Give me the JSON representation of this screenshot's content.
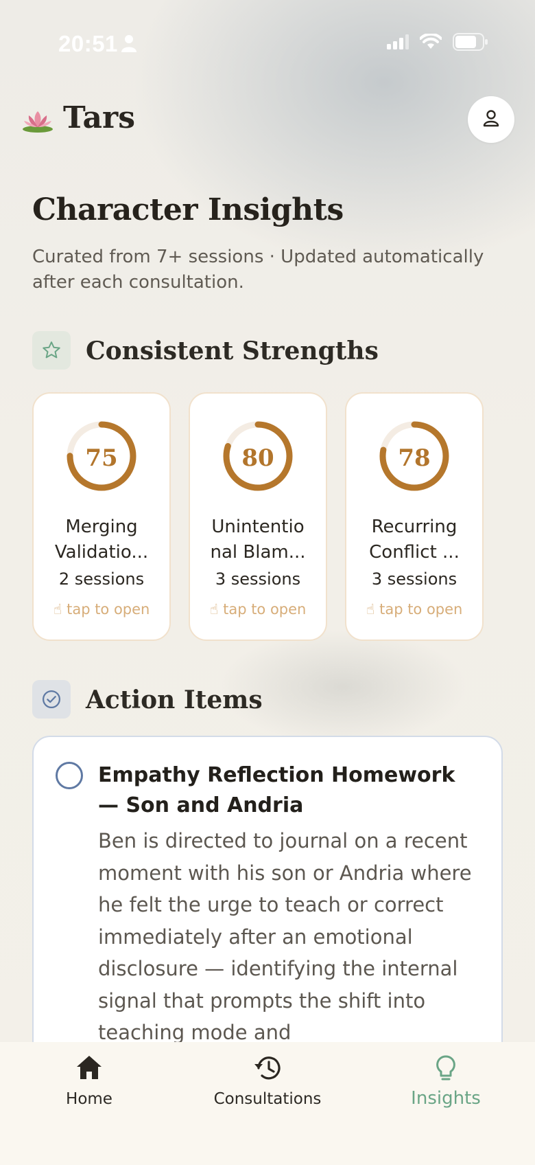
{
  "status_bar": {
    "time": "20:51"
  },
  "header": {
    "app_name": "Tars"
  },
  "page": {
    "title": "Character Insights",
    "subtitle": "Curated from 7+ sessions · Updated automatically after each consultation."
  },
  "strengths": {
    "title": "Consistent Strengths",
    "cards": [
      {
        "score": "75",
        "progress": 0.75,
        "label": "Merging Validatio...",
        "sessions": "2 sessions",
        "tap": "tap to open"
      },
      {
        "score": "80",
        "progress": 0.8,
        "label": "Unintentio nal Blam...",
        "sessions": "3 sessions",
        "tap": "tap to open"
      },
      {
        "score": "78",
        "progress": 0.78,
        "label": "Recurring Conflict ...",
        "sessions": "3 sessions",
        "tap": "tap to open"
      }
    ]
  },
  "actions": {
    "title": "Action Items",
    "items": [
      {
        "title": "Empathy Reflection Homework — Son and Andria",
        "body": "Ben is directed to journal on a recent moment with his son or Andria where he felt the urge to teach or correct immediately after an emotional disclosure — identifying the internal signal that prompts the shift into teaching mode and"
      }
    ]
  },
  "tabbar": {
    "tabs": [
      {
        "label": "Home"
      },
      {
        "label": "Consultations"
      },
      {
        "label": "Insights"
      }
    ],
    "active": "Insights"
  },
  "colors": {
    "accent_gold": "#b2752c",
    "accent_green": "#6aa586",
    "accent_blue": "#5f79a3"
  }
}
